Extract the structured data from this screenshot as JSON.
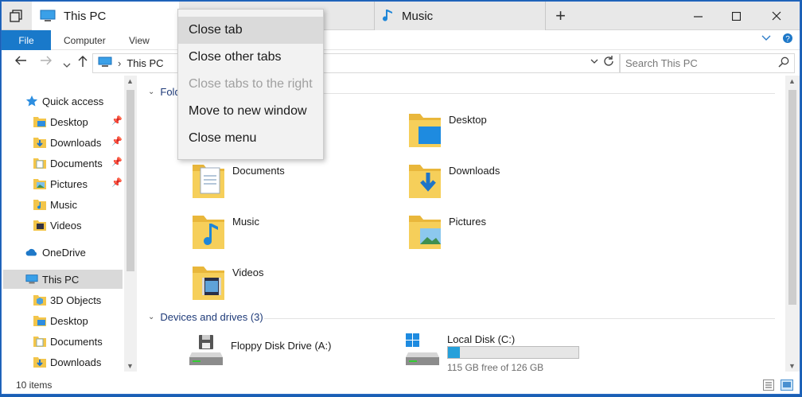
{
  "tabs": {
    "active_label": "This PC",
    "inactive_label": "Music"
  },
  "ribbon": {
    "file": "File",
    "computer": "Computer",
    "view": "View"
  },
  "address": {
    "path": "This PC",
    "search_placeholder": "Search This PC"
  },
  "nav_pane": {
    "quick_access": "Quick access",
    "quick_items": [
      "Desktop",
      "Downloads",
      "Documents",
      "Pictures",
      "Music",
      "Videos"
    ],
    "onedrive": "OneDrive",
    "this_pc": "This PC",
    "pc_items": [
      "3D Objects",
      "Desktop",
      "Documents",
      "Downloads"
    ]
  },
  "folders": {
    "header": "Folders (6)",
    "items": [
      "Desktop",
      "Documents",
      "Downloads",
      "Music",
      "Pictures",
      "Videos"
    ]
  },
  "devices": {
    "header": "Devices and drives (3)",
    "floppy": "Floppy Disk Drive (A:)",
    "local_disk": "Local Disk (C:)",
    "local_free": "115 GB free of 126 GB",
    "local_used_fraction": 0.09
  },
  "status": {
    "items_count": "10 items"
  },
  "context_menu": {
    "close_tab": "Close tab",
    "close_other_tabs": "Close other tabs",
    "close_tabs_right": "Close tabs to the right",
    "move_new_window": "Move to new window",
    "close_menu": "Close menu"
  },
  "colors": {
    "accent": "#1979ca",
    "folder": "#f3c54a",
    "drive_fill": "#26a0da"
  }
}
